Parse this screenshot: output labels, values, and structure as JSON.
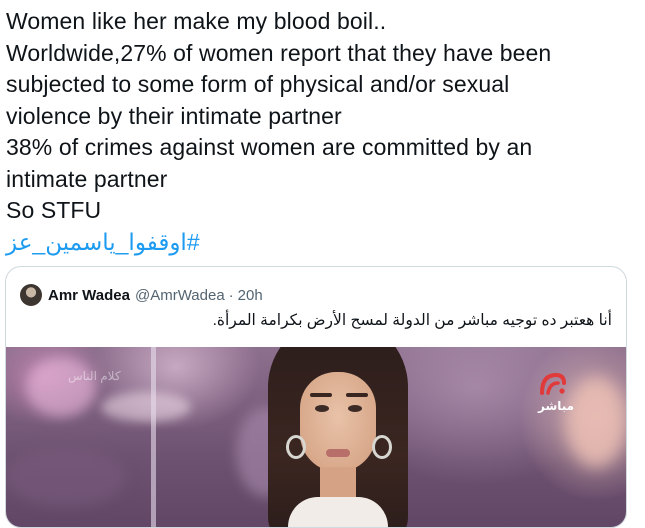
{
  "tweet": {
    "lines": [
      "Women like her make my blood boil..",
      "Worldwide,27% of women report that they have been",
      "subjected to some form of physical and/or sexual",
      "violence by their intimate partner",
      "38% of crimes against women are committed by an",
      "intimate partner",
      "So STFU"
    ],
    "hashtag": "#اوقفوا_ياسمين_عز"
  },
  "quoted_tweet": {
    "name": "Amr Wadea",
    "handle": "@AmrWadea",
    "separator": "·",
    "time": "20h",
    "text": "أنا هعتبر ده توجيه مباشر من الدولة لمسح الأرض بكرامة المرأة.",
    "media": {
      "channel_label": "مباشر",
      "watermark": "كلام الناس"
    }
  },
  "colors": {
    "text": "#0f1419",
    "secondary": "#536471",
    "link": "#1d9bf0",
    "border": "#cfd9de"
  }
}
